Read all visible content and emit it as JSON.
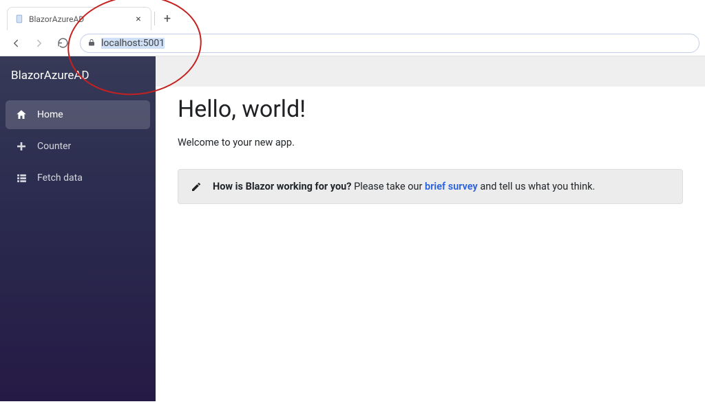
{
  "browser": {
    "tab_title": "BlazorAzureAD",
    "url": "localhost:5001"
  },
  "sidebar": {
    "brand": "BlazorAzureAD",
    "items": [
      {
        "label": "Home",
        "icon": "home-icon",
        "active": true
      },
      {
        "label": "Counter",
        "icon": "plus-icon",
        "active": false
      },
      {
        "label": "Fetch data",
        "icon": "list-icon",
        "active": false
      }
    ]
  },
  "main": {
    "heading": "Hello, world!",
    "welcome": "Welcome to your new app.",
    "survey": {
      "bold": "How is Blazor working for you?",
      "before_link": " Please take our ",
      "link_text": "brief survey",
      "after_link": " and tell us what you think."
    }
  }
}
